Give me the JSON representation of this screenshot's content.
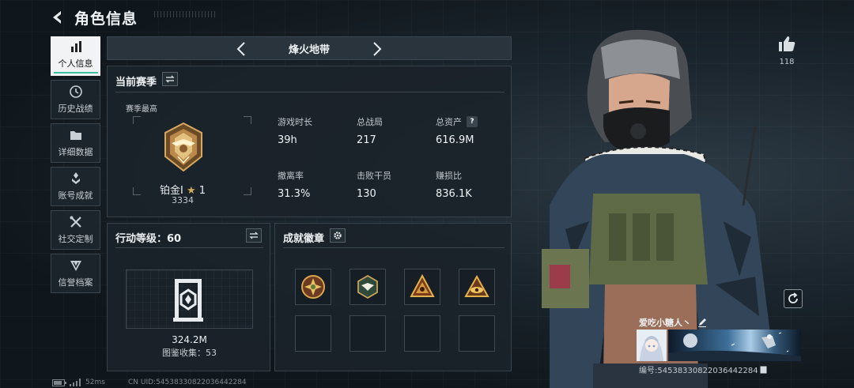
{
  "header": {
    "title": "角色信息"
  },
  "sidebar": {
    "items": [
      {
        "label": "个人信息",
        "icon": "bar-chart-icon",
        "active": true
      },
      {
        "label": "历史战绩",
        "icon": "history-icon",
        "active": false
      },
      {
        "label": "详细数据",
        "icon": "folder-icon",
        "active": false
      },
      {
        "label": "账号成就",
        "icon": "achievement-icon",
        "active": false
      },
      {
        "label": "社交定制",
        "icon": "tools-icon",
        "active": false
      },
      {
        "label": "信誉档案",
        "icon": "shield-icon",
        "active": false
      }
    ]
  },
  "season_selector": {
    "name": "烽火地带"
  },
  "current_season": {
    "title": "当前赛季",
    "best_label": "赛季最高",
    "rank": {
      "name": "铂金Ⅰ",
      "stars": "1",
      "score": "3334"
    },
    "stats": [
      {
        "label": "游戏时长",
        "value": "39h"
      },
      {
        "label": "总战局",
        "value": "217"
      },
      {
        "label": "总资产",
        "value": "616.9M",
        "help": "?"
      },
      {
        "label": "撤离率",
        "value": "31.3%"
      },
      {
        "label": "击败干员",
        "value": "130"
      },
      {
        "label": "赚损比",
        "value": "836.1K"
      }
    ]
  },
  "action_level": {
    "title": "行动等级：60",
    "value": "324.2M",
    "collection": "图鉴收集：53"
  },
  "badges": {
    "title": "成就徽章"
  },
  "profile": {
    "likes": "118",
    "player_name": "爱吃小糖人丶",
    "player_id": "编号:5453833082203644228​4"
  },
  "status_bar": {
    "ping": "52ms",
    "uid": "CN UID:54538330822036442284"
  },
  "colors": {
    "accent": "#3dc1a3",
    "gold": "#c79a4a",
    "panel": "#1b232a"
  }
}
